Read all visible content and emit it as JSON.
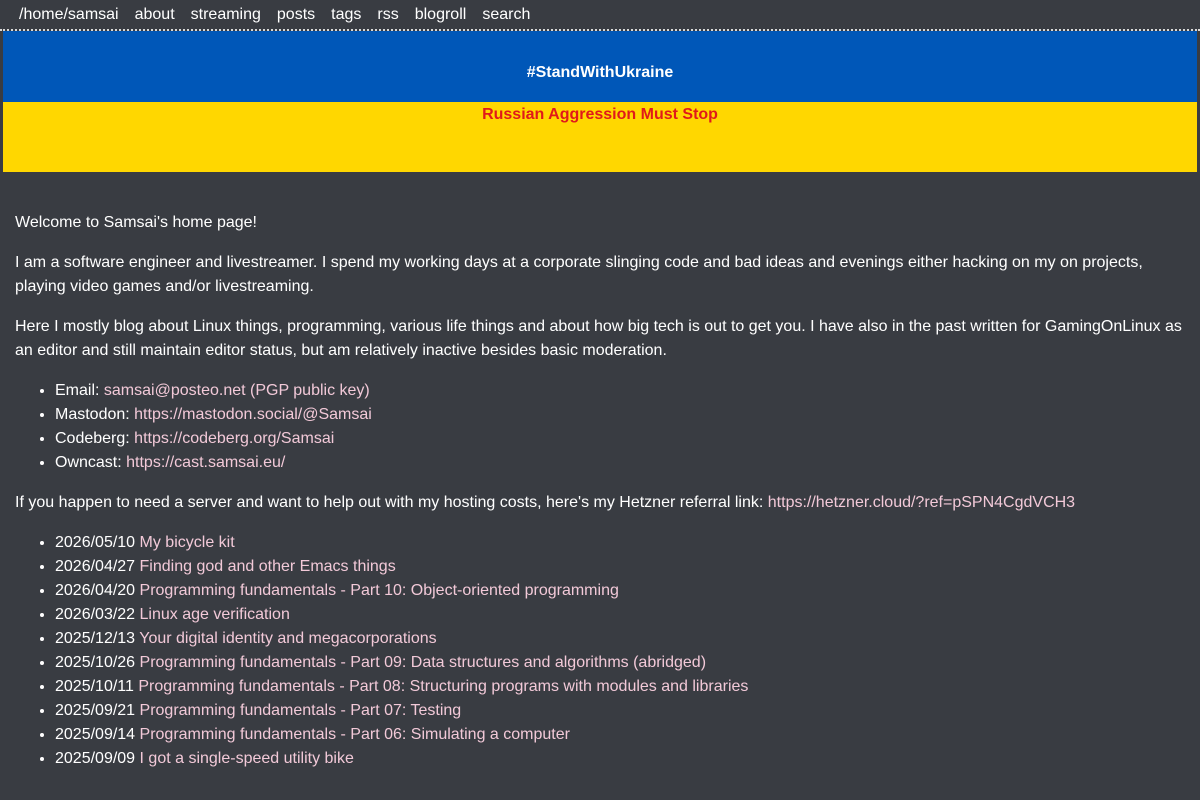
{
  "nav": {
    "items": [
      "/home/samsai",
      "about",
      "streaming",
      "posts",
      "tags",
      "rss",
      "blogroll",
      "search"
    ]
  },
  "banner": {
    "top_text": "#StandWithUkraine",
    "bottom_text": "Russian Aggression Must Stop",
    "colors": {
      "blue": "#0057b8",
      "yellow": "#ffd700",
      "red_text": "#e01a1a"
    }
  },
  "intro": {
    "welcome": "Welcome to Samsai's home page!",
    "para1": "I am a software engineer and livestreamer. I spend my working days at a corporate slinging code and bad ideas and evenings either hacking on my on projects, playing video games and/or livestreaming.",
    "para2": "Here I mostly blog about Linux things, programming, various life things and about how big tech is out to get you. I have also in the past written for GamingOnLinux as an editor and still maintain editor status, but am relatively inactive besides basic moderation."
  },
  "contacts": [
    {
      "label": "Email: ",
      "link": "samsai@posteo.net (PGP public key)"
    },
    {
      "label": "Mastodon: ",
      "link": "https://mastodon.social/@Samsai"
    },
    {
      "label": "Codeberg: ",
      "link": "https://codeberg.org/Samsai"
    },
    {
      "label": "Owncast: ",
      "link": "https://cast.samsai.eu/"
    }
  ],
  "hosting": {
    "text": "If you happen to need a server and want to help out with my hosting costs, here's my Hetzner referral link: ",
    "link": "https://hetzner.cloud/?ref=pSPN4CgdVCH3"
  },
  "posts": [
    {
      "date": "2026/05/10 ",
      "title": "My bicycle kit"
    },
    {
      "date": "2026/04/27 ",
      "title": "Finding god and other Emacs things"
    },
    {
      "date": "2026/04/20 ",
      "title": "Programming fundamentals - Part 10: Object-oriented programming"
    },
    {
      "date": "2026/03/22 ",
      "title": "Linux age verification"
    },
    {
      "date": "2025/12/13 ",
      "title": "Your digital identity and megacorporations"
    },
    {
      "date": "2025/10/26 ",
      "title": "Programming fundamentals - Part 09: Data structures and algorithms (abridged)"
    },
    {
      "date": "2025/10/11 ",
      "title": "Programming fundamentals - Part 08: Structuring programs with modules and libraries"
    },
    {
      "date": "2025/09/21 ",
      "title": "Programming fundamentals - Part 07: Testing"
    },
    {
      "date": "2025/09/14 ",
      "title": "Programming fundamentals - Part 06: Simulating a computer"
    },
    {
      "date": "2025/09/09 ",
      "title": "I got a single-speed utility bike"
    }
  ],
  "theme": {
    "background": "#393c42",
    "link_color": "#f2c9d8"
  }
}
